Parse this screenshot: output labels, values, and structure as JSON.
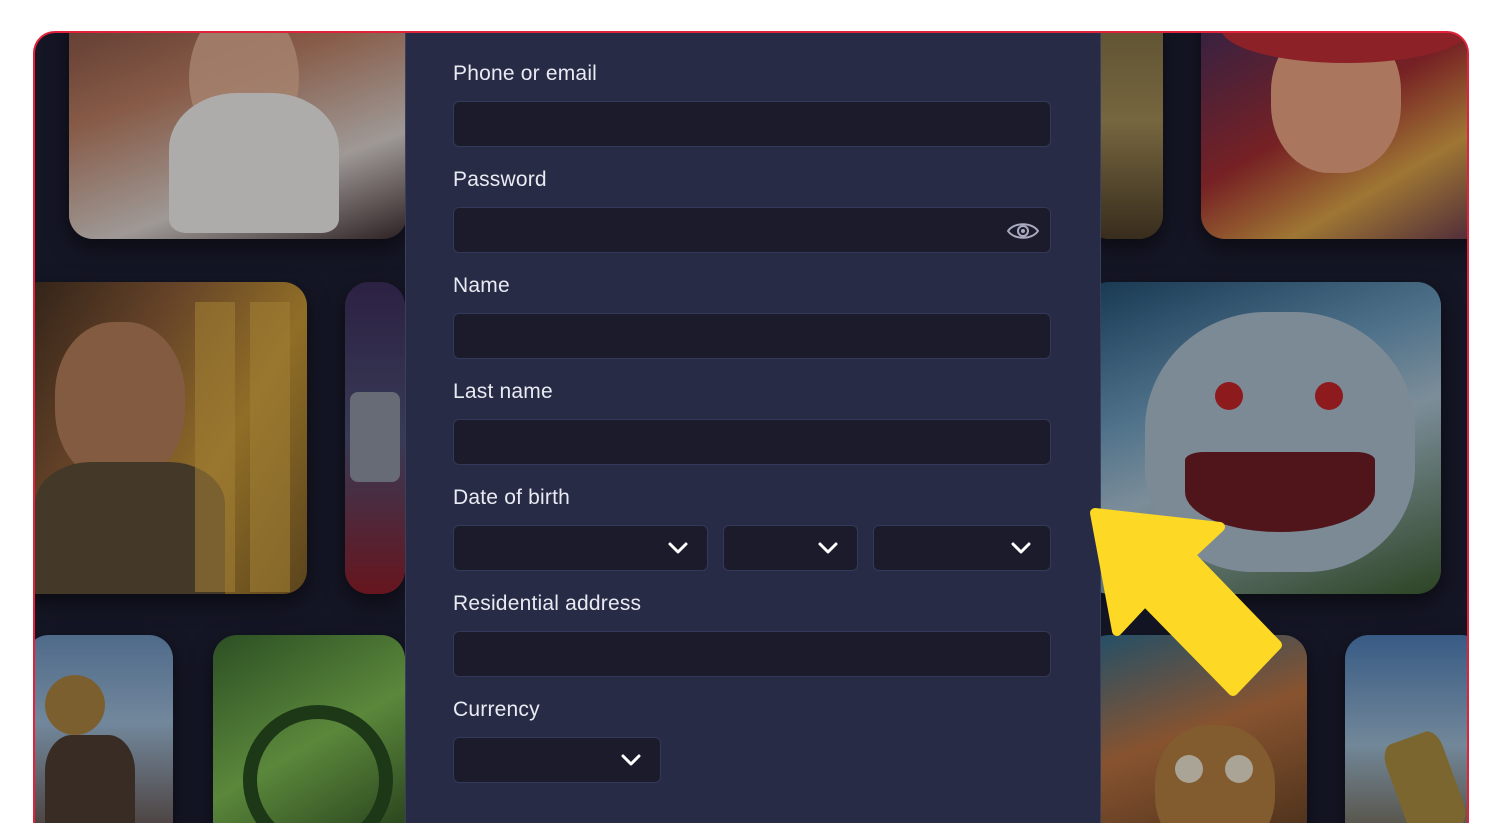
{
  "form": {
    "phone_label": "Phone or email",
    "phone_value": "",
    "password_label": "Password",
    "password_value": "",
    "name_label": "Name",
    "name_value": "",
    "lastname_label": "Last name",
    "lastname_value": "",
    "dob_label": "Date of birth",
    "dob_day": "",
    "dob_month": "",
    "dob_year": "",
    "address_label": "Residential address",
    "address_value": "",
    "currency_label": "Currency",
    "currency_value": ""
  },
  "icons": {
    "password_toggle": "eye-icon",
    "dropdown": "chevron-down-icon",
    "pointer": "arrow-annotation"
  },
  "colors": {
    "frame_border": "#e0233a",
    "panel_bg": "#272b45",
    "input_bg": "#1b1b2b",
    "arrow": "#fdd824"
  }
}
